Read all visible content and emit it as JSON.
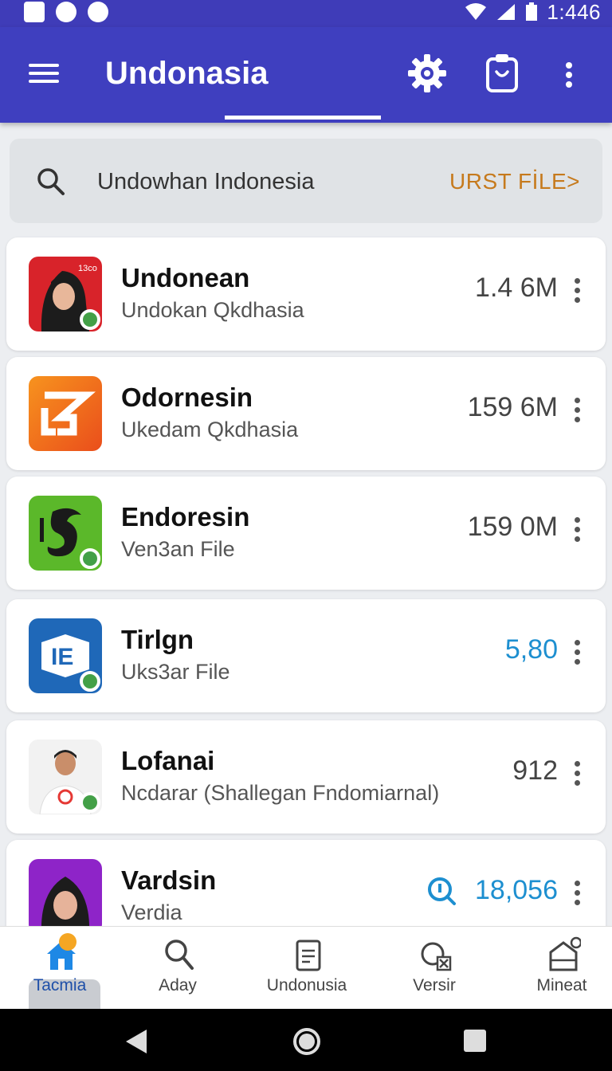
{
  "status_bar": {
    "time": "1:446"
  },
  "app_bar": {
    "title": "Undonasia"
  },
  "search": {
    "query": "Undowhan Indonesia",
    "action_label": "URST FİLE>"
  },
  "list": [
    {
      "title": "Undonean",
      "subtitle": "Undokan Qkdhasia",
      "value": "1.4 6M",
      "icon": "person-avatar",
      "icon_text": "13co",
      "accent": false
    },
    {
      "title": "Odornesin",
      "subtitle": "Ukedam Qkdhasia",
      "value": "159 6M",
      "icon": "orange-logo",
      "accent": false
    },
    {
      "title": "Endoresin",
      "subtitle": "Ven3an File",
      "value": "159 0M",
      "icon": "green-dragon",
      "accent": false
    },
    {
      "title": "Tirlgn",
      "subtitle": "Uks3ar File",
      "value": "5,80",
      "icon": "blue-ie-logo",
      "icon_text": "IE",
      "accent": true
    },
    {
      "title": "Lofanai",
      "subtitle": "Ncdarar (Shallegan Fndomiarnal)",
      "value": "912",
      "icon": "person-photo",
      "accent": false
    },
    {
      "title": "Vardsin",
      "subtitle": "Verdia",
      "value": "18,056",
      "icon": "purple-avatar",
      "accent": true
    }
  ],
  "bottom_nav": [
    {
      "label": "Tacmia",
      "icon": "home-icon"
    },
    {
      "label": "Aday",
      "icon": "search-icon"
    },
    {
      "label": "Undonusia",
      "icon": "document-icon"
    },
    {
      "label": "Versir",
      "icon": "chat-close-icon"
    },
    {
      "label": "Mineat",
      "icon": "inbox-icon"
    }
  ],
  "colors": {
    "primary": "#3f3fbf",
    "accent": "#1d8fd0",
    "action": "#c67a1d"
  }
}
